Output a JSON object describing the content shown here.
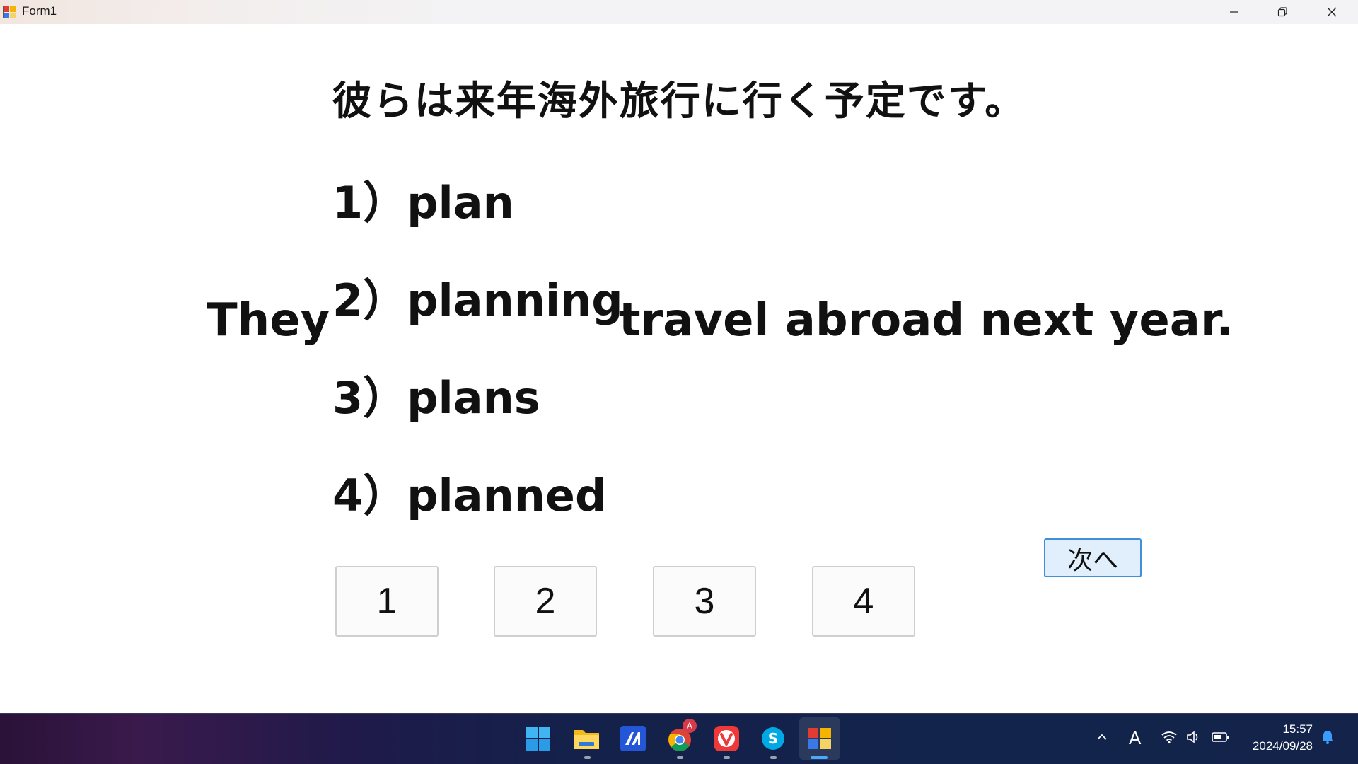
{
  "window": {
    "title": "Form1",
    "controls": {
      "minimize_icon": "minimize-icon",
      "restore_icon": "restore-icon",
      "close_icon": "close-icon"
    }
  },
  "question": {
    "japanese": "彼らは来年海外旅行に行く予定です。",
    "sentence_start": "They",
    "sentence_end": "travel abroad next year.",
    "choices": [
      {
        "number": "1）",
        "word": "plan"
      },
      {
        "number": "2）",
        "word": "planning"
      },
      {
        "number": "3）",
        "word": "plans"
      },
      {
        "number": "4）",
        "word": "planned"
      }
    ]
  },
  "answer_buttons": [
    "1",
    "2",
    "3",
    "4"
  ],
  "next_button": "次へ",
  "taskbar": {
    "apps": [
      "start",
      "file-explorer",
      "code-editor",
      "chrome",
      "vivaldi",
      "skype",
      "form-app"
    ],
    "chrome_badge": "A",
    "tray": {
      "ime": "A"
    },
    "clock": {
      "time": "15:57",
      "date": "2024/09/28"
    }
  },
  "colors": {
    "accent": "#3f8fd9",
    "next_bg": "#e1eefb",
    "taskbar": "#1a1f4a"
  }
}
